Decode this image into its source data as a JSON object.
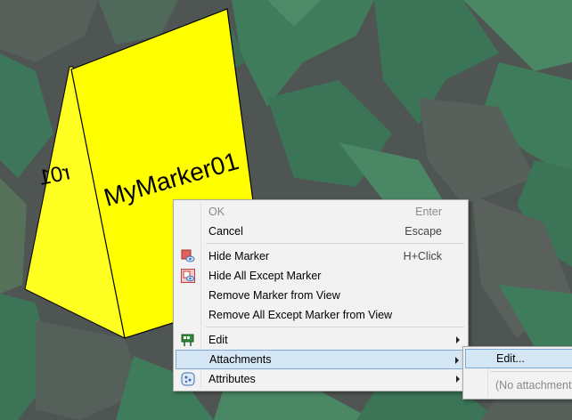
{
  "marker": {
    "label_front": "MyMarker01",
    "label_back": "r01",
    "color": "#ffff00"
  },
  "terrain_colors": {
    "green": "#3d7a5a",
    "gray": "#5a5e5c"
  },
  "context_menu": {
    "items": [
      {
        "label": "OK",
        "shortcut": "Enter",
        "disabled": true
      },
      {
        "label": "Cancel",
        "shortcut": "Escape"
      },
      {
        "label": "Hide Marker",
        "shortcut": "H+Click",
        "icon": "hide-marker-icon"
      },
      {
        "label": "Hide All Except Marker",
        "icon": "hide-all-except-icon"
      },
      {
        "label": "Remove Marker from View"
      },
      {
        "label": "Remove All Except Marker from View"
      },
      {
        "label": "Edit",
        "icon": "edit-flag-icon",
        "submenu": true
      },
      {
        "label": "Attachments",
        "submenu": true,
        "highlighted": true
      },
      {
        "label": "Attributes",
        "icon": "attributes-icon",
        "submenu": true
      }
    ]
  },
  "submenu": {
    "items": [
      {
        "label": "Edit...",
        "highlighted": true
      },
      {
        "label": "(No attachments",
        "disabled": true
      }
    ]
  }
}
